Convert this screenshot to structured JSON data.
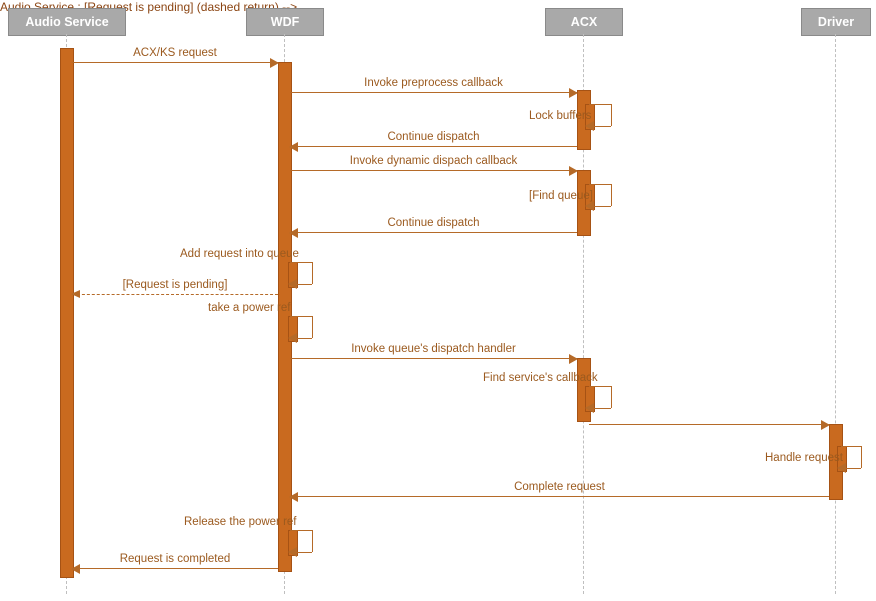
{
  "participants": {
    "audio_service": "Audio Service",
    "wdf": "WDF",
    "acx": "ACX",
    "driver": "Driver"
  },
  "messages": {
    "acx_ks_request": "ACX/KS request",
    "invoke_preprocess": "Invoke preprocess callback",
    "lock_buffers": "Lock buffers",
    "continue_dispatch_1": "Continue dispatch",
    "invoke_dynamic_dispatch": "Invoke dynamic dispach callback",
    "find_queue": "[Find queue]",
    "continue_dispatch_2": "Continue dispatch",
    "add_request_queue": "Add request into queue",
    "request_pending": "[Request is pending]",
    "take_power_ref": "take a power ref",
    "invoke_queue_handler": "Invoke queue's dispatch handler",
    "find_service_callback": "Find service's callback",
    "handle_request": "Handle request",
    "complete_request": "Complete request",
    "release_power_ref": "Release the power ref",
    "request_completed": "Request is completed"
  },
  "colors": {
    "bar": "#c96a1f",
    "line": "#b56a28",
    "text": "#9b5a1f",
    "header_bg": "#a9a9a9"
  }
}
